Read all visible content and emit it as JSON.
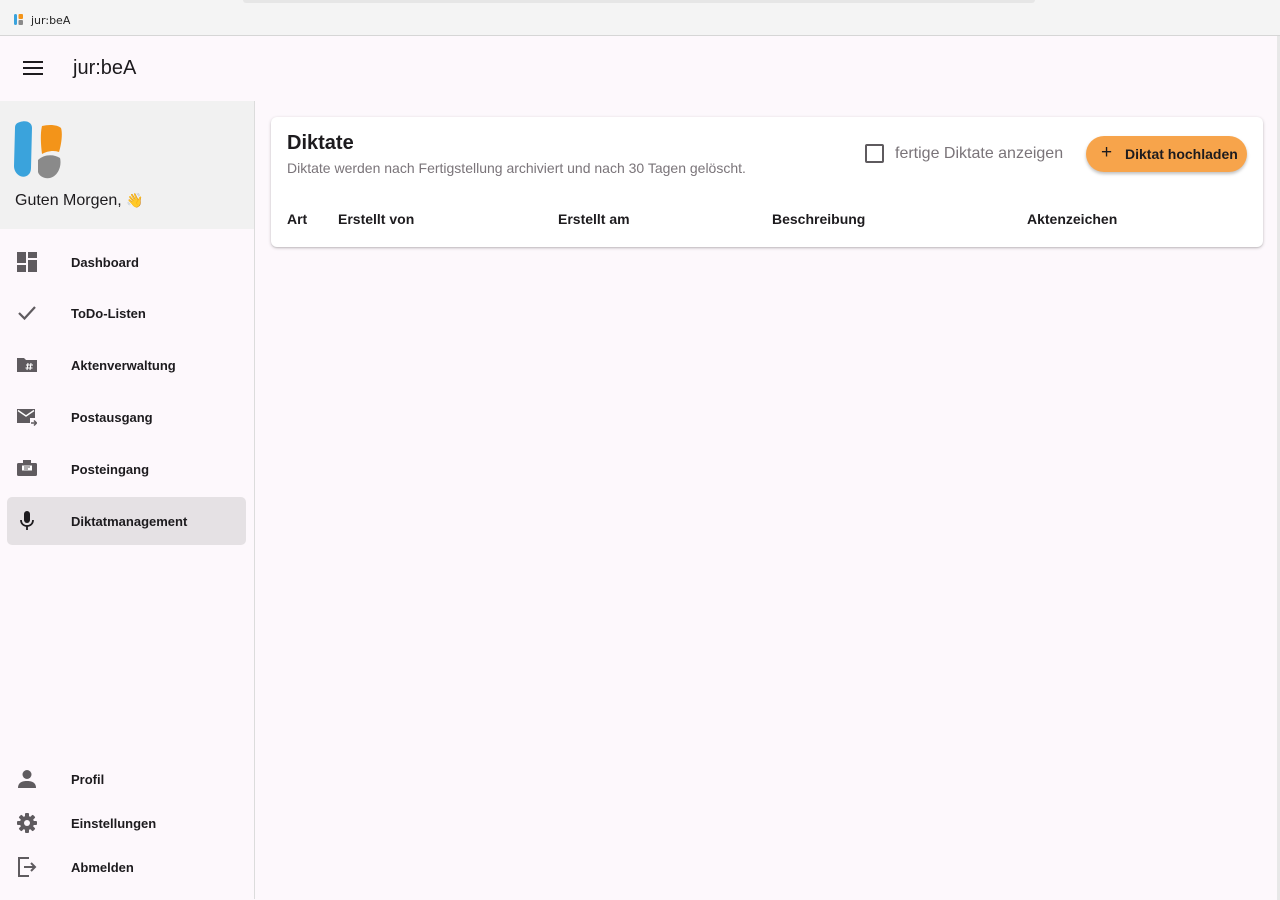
{
  "window": {
    "title": "jur:beA"
  },
  "header": {
    "title": "jur:beA",
    "menu_icon": "menu-icon"
  },
  "sidebar": {
    "greeting": "Guten Morgen,",
    "greeting_emoji": "👋",
    "items": [
      {
        "label": "Dashboard",
        "icon": "dashboard-icon",
        "active": false
      },
      {
        "label": "ToDo-Listen",
        "icon": "check-icon",
        "active": false
      },
      {
        "label": "Aktenverwaltung",
        "icon": "folder-hash-icon",
        "active": false
      },
      {
        "label": "Postausgang",
        "icon": "mail-send-icon",
        "active": false
      },
      {
        "label": "Posteingang",
        "icon": "inbox-icon",
        "active": false
      },
      {
        "label": "Diktatmanagement",
        "icon": "mic-icon",
        "active": true
      }
    ],
    "bottom_items": [
      {
        "label": "Profil",
        "icon": "person-icon"
      },
      {
        "label": "Einstellungen",
        "icon": "gear-icon"
      },
      {
        "label": "Abmelden",
        "icon": "logout-icon"
      }
    ]
  },
  "main": {
    "title": "Diktate",
    "subtitle": "Diktate werden nach Fertigstellung archiviert und nach 30 Tagen gelöscht.",
    "show_finished_label": "fertige Diktate anzeigen",
    "show_finished_checked": false,
    "upload_button": {
      "icon": "+",
      "label": "Diktat hochladen"
    },
    "columns": [
      "Art",
      "Erstellt von",
      "Erstellt am",
      "Beschreibung",
      "Aktenzeichen"
    ],
    "rows": []
  },
  "colors": {
    "accent": "#f7a44b",
    "logo_blue": "#3aa3dc",
    "logo_orange": "#f39419",
    "logo_gray": "#8a8a8a",
    "active_nav": "#e5e1e4",
    "icon_gray": "#5f5b5f"
  }
}
